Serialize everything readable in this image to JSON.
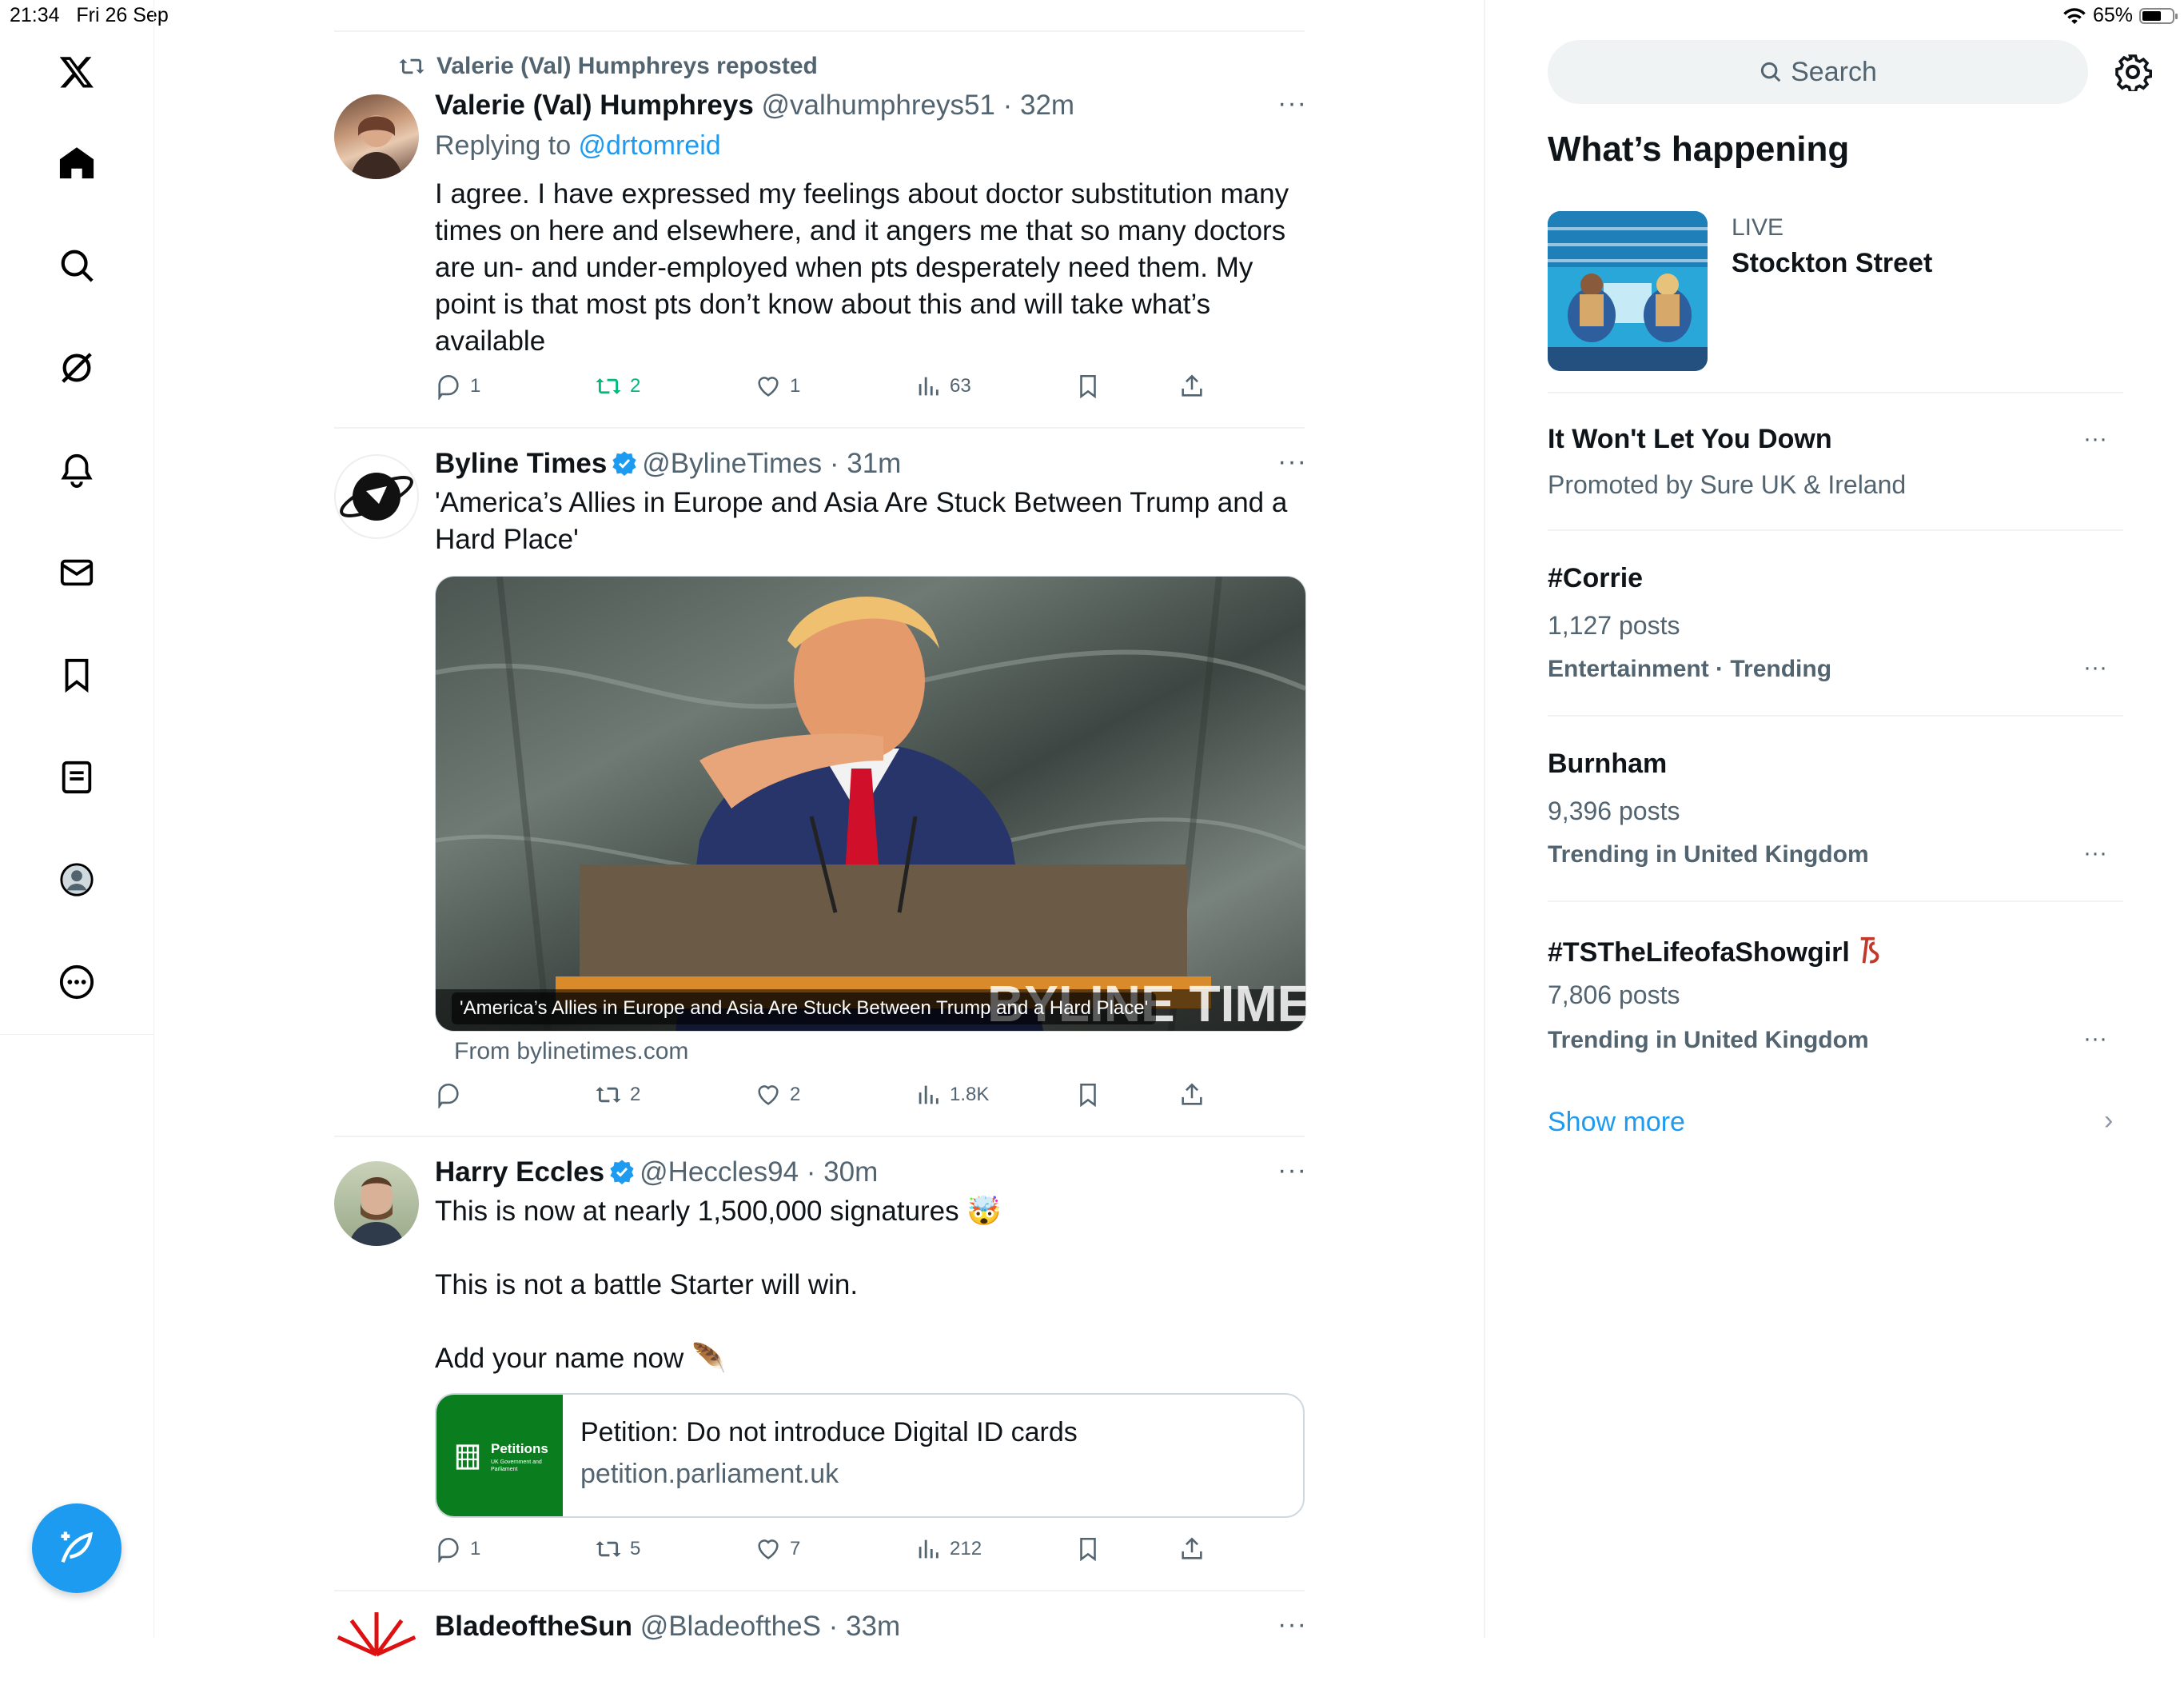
{
  "status_bar": {
    "time": "21:34",
    "date": "Fri 26 Sep",
    "battery": "65%",
    "battery_fill": 0.65
  },
  "nav": {
    "items": [
      {
        "icon": "x-logo-icon"
      },
      {
        "icon": "home-icon"
      },
      {
        "icon": "search-icon"
      },
      {
        "icon": "grok-icon"
      },
      {
        "icon": "bell-icon"
      },
      {
        "icon": "mail-icon"
      },
      {
        "icon": "bookmark-icon"
      },
      {
        "icon": "lists-icon"
      },
      {
        "icon": "profile-icon"
      },
      {
        "icon": "more-circle-icon"
      }
    ],
    "compose_icon": "compose-icon"
  },
  "feed": {
    "top_actions_visible": true,
    "tweets": [
      {
        "repost_label": "Valerie (Val) Humphreys reposted",
        "name": "Valerie (Val) Humphreys",
        "handle": "@valhumphreys51",
        "time": "32m",
        "replying_prefix": "Replying to ",
        "replying_to": "@drtomreid",
        "lines": [
          "I agree. I have expressed my feelings about doctor substitution many",
          "times on here and elsewhere, and it angers me that so many doctors",
          "are un- and under-employed when pts desperately need them. My",
          "point is that most pts don’t know about this and will take what’s",
          "available"
        ],
        "replies": "1",
        "reposts": "2",
        "likes": "1",
        "views": "63"
      },
      {
        "name": "Byline Times",
        "handle": "@BylineTimes",
        "time": "31m",
        "lines": [
          "'America’s Allies in Europe and Asia Are Stuck Between Trump and a",
          "Hard Place'"
        ],
        "media_caption": "'America’s Allies in Europe and Asia Are Stuck Between Trump and a Hard Place'",
        "media_watermark": "BYLINE TIMES",
        "source": "From bylinetimes.com",
        "replies": "",
        "reposts": "2",
        "likes": "2",
        "views": "1.8K"
      },
      {
        "name": "Harry Eccles",
        "handle": "@Heccles94",
        "time": "30m",
        "line1": "This is now at nearly 1,500,000 signatures 🤯",
        "line2": "This is not a battle Starter will win.",
        "line3": "Add your name now 🪶",
        "card_title": "Petition: Do not introduce Digital ID cards",
        "card_domain": "petition.parliament.uk",
        "card_logo_text": "Petitions",
        "card_logo_sub": "UK Government and Parliament",
        "replies": "1",
        "reposts": "5",
        "likes": "7",
        "views": "212"
      },
      {
        "name": "BladeoftheSun",
        "handle": "@BladeoftheS",
        "time": "33m"
      }
    ]
  },
  "sidebar": {
    "search_placeholder": "Search",
    "title": "What’s happening",
    "live": {
      "label": "LIVE",
      "title": "Stockton Street"
    },
    "trends": [
      {
        "name": "It Won't Let You Down",
        "meta": "Promoted by Sure UK & Ireland"
      },
      {
        "name": "#Corrie",
        "meta": "1,127 posts",
        "sub": "Entertainment · Trending"
      },
      {
        "name": "Burnham",
        "meta": "9,396 posts",
        "sub": "Trending in United Kingdom"
      },
      {
        "name": "#TSTheLifeofaShowgirl",
        "meta": "7,806 posts",
        "sub": "Trending in United Kingdom"
      }
    ],
    "show_more": "Show more"
  },
  "colors": {
    "accent": "#1d9bf0",
    "repost_green": "#00ba7c",
    "text": "#0f1419",
    "muted": "#536471"
  }
}
